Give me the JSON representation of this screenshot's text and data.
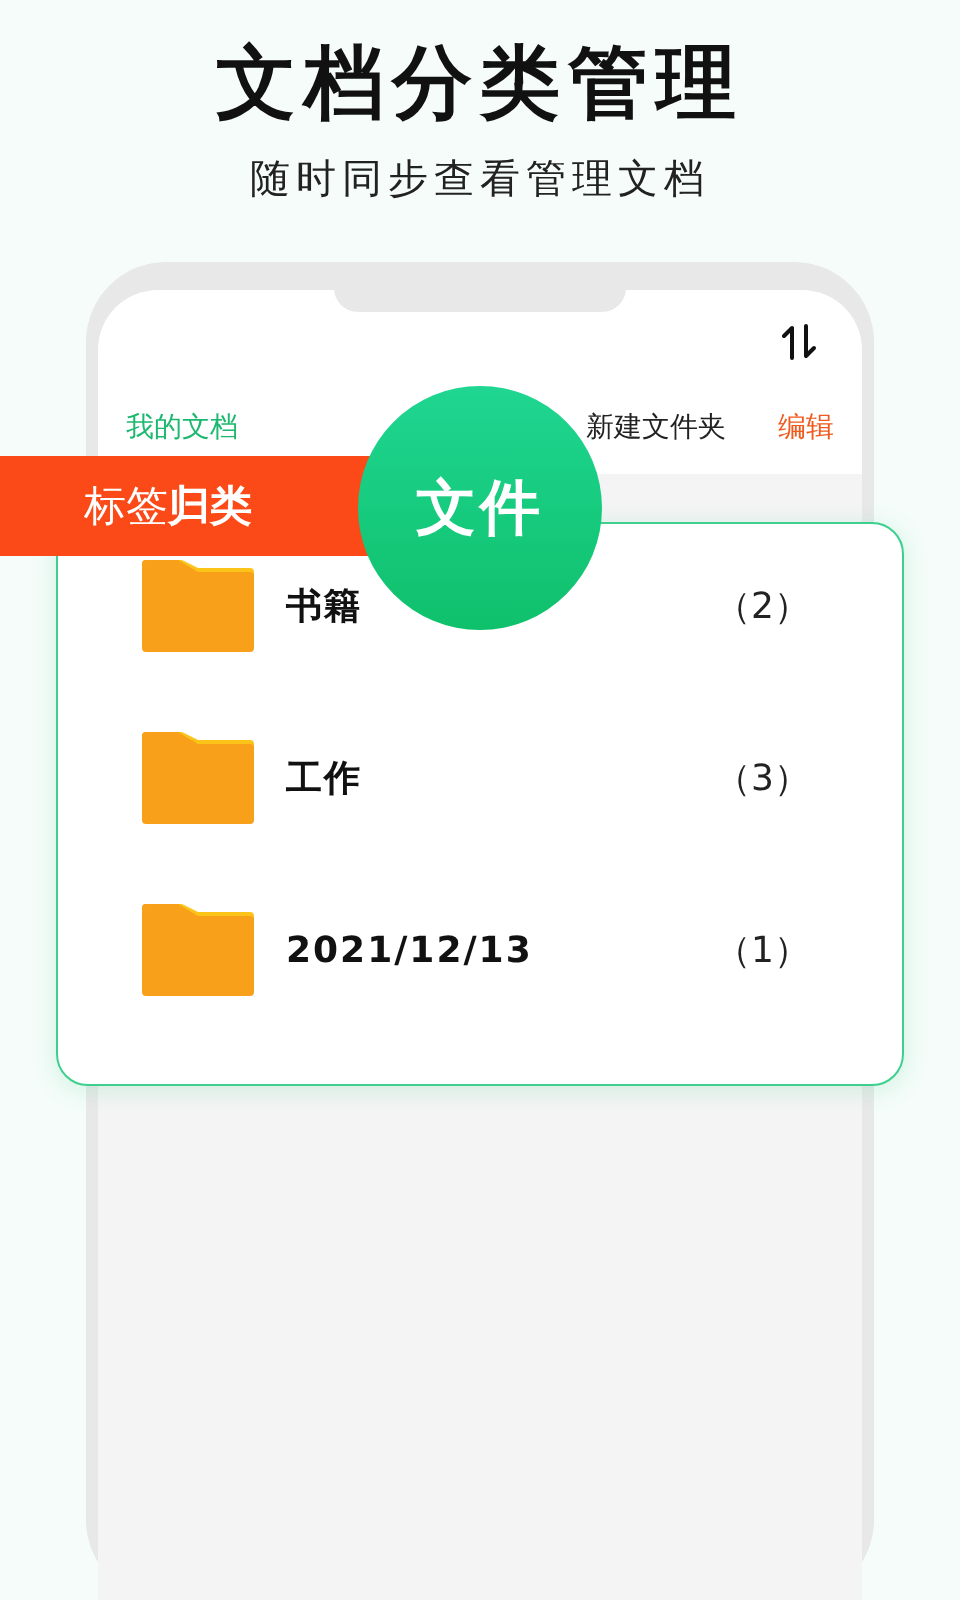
{
  "headline": "文档分类管理",
  "subheadline": "随时同步查看管理文档",
  "phone": {
    "tabs": [
      {
        "label": "我的文档",
        "kind": "title"
      },
      {
        "label": "新建文件夹",
        "kind": "action"
      },
      {
        "label": "编辑",
        "kind": "edit"
      }
    ]
  },
  "banner": "标签**归类**",
  "badge": "文件",
  "folders": [
    {
      "name": "书籍",
      "count": "（2）"
    },
    {
      "name": "工作",
      "count": "（3）"
    },
    {
      "name": "2021/12/13",
      "count": "（1）"
    }
  ]
}
